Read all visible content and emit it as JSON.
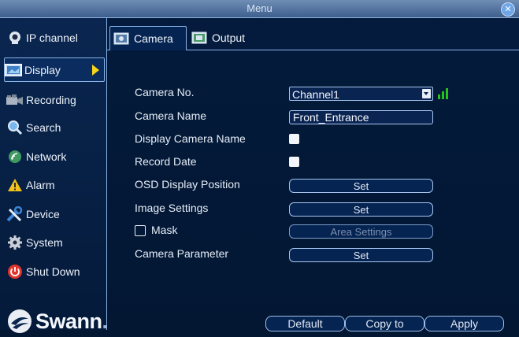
{
  "window": {
    "title": "Menu",
    "close_icon": "close-icon"
  },
  "sidebar": {
    "items": [
      {
        "label": "IP channel",
        "icon": "ip-camera-icon"
      },
      {
        "label": "Display",
        "icon": "display-icon",
        "active": true
      },
      {
        "label": "Recording",
        "icon": "recording-icon"
      },
      {
        "label": "Search",
        "icon": "search-icon"
      },
      {
        "label": "Network",
        "icon": "network-icon"
      },
      {
        "label": "Alarm",
        "icon": "alarm-icon"
      },
      {
        "label": "Device",
        "icon": "device-tools-icon"
      },
      {
        "label": "System",
        "icon": "gear-icon"
      },
      {
        "label": "Shut Down",
        "icon": "power-icon"
      }
    ],
    "logo": {
      "text": "Swann"
    }
  },
  "tabs": [
    {
      "label": "Camera",
      "icon": "camera-tab-icon",
      "active": true
    },
    {
      "label": "Output",
      "icon": "output-tab-icon"
    }
  ],
  "form": {
    "camera_no": {
      "label": "Camera No.",
      "value": "Channel1"
    },
    "camera_name": {
      "label": "Camera Name",
      "value": "Front_Entrance"
    },
    "display_camera_name": {
      "label": "Display Camera Name",
      "checked": true
    },
    "record_date": {
      "label": "Record Date",
      "checked": true
    },
    "osd_display_position": {
      "label": "OSD Display Position",
      "button": "Set"
    },
    "image_settings": {
      "label": "Image Settings",
      "button": "Set"
    },
    "mask": {
      "label": "Mask",
      "checked": false,
      "button": "Area Settings"
    },
    "camera_parameter": {
      "label": "Camera Parameter",
      "button": "Set"
    }
  },
  "footer": {
    "default": "Default",
    "copy_to": "Copy to",
    "apply": "Apply"
  },
  "colors": {
    "accent": "#8ab3e6",
    "signal": "#27c31b",
    "active_arrow": "#f7d51a",
    "background": "#031733"
  }
}
